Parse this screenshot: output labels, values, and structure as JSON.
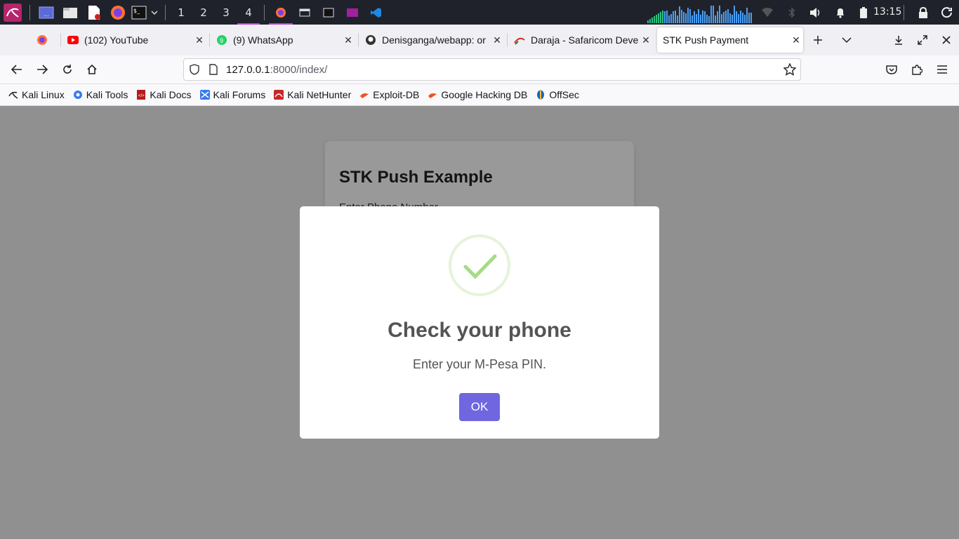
{
  "panel": {
    "workspaces": [
      "1",
      "2",
      "3",
      "4"
    ],
    "active_workspace": "4",
    "clock": "13:15"
  },
  "tabs": [
    {
      "title": "",
      "icon": "firefox-icon"
    },
    {
      "title": "(102) YouTube",
      "icon": "youtube-icon"
    },
    {
      "title": "(9) WhatsApp",
      "icon": "whatsapp-icon"
    },
    {
      "title": "Denisganga/webapp: or",
      "icon": "github-icon"
    },
    {
      "title": "Daraja - Safaricom Deve",
      "icon": "daraja-icon"
    },
    {
      "title": "STK Push Payment",
      "icon": "",
      "active": true
    }
  ],
  "address": {
    "host": "127.0.0.1",
    "path": ":8000/index/"
  },
  "bookmarks": [
    {
      "label": "Kali Linux",
      "icon": "kali-icon"
    },
    {
      "label": "Kali Tools",
      "icon": "kali-tools-icon"
    },
    {
      "label": "Kali Docs",
      "icon": "kali-docs-icon"
    },
    {
      "label": "Kali Forums",
      "icon": "kali-forums-icon"
    },
    {
      "label": "Kali NetHunter",
      "icon": "nethunter-icon"
    },
    {
      "label": "Exploit-DB",
      "icon": "exploit-db-icon"
    },
    {
      "label": "Google Hacking DB",
      "icon": "ghdb-icon"
    },
    {
      "label": "OffSec",
      "icon": "offsec-icon"
    }
  ],
  "page": {
    "heading": "STK Push Example",
    "phone_label": "Enter Phone Number"
  },
  "modal": {
    "title": "Check your phone",
    "message": "Enter your M-Pesa PIN.",
    "ok_label": "OK"
  },
  "colors": {
    "kali_panel": "#1f222b",
    "confirm_button": "#7066e0",
    "success_green": "#a5dc86",
    "workspace_accent": "#c13bd8"
  }
}
